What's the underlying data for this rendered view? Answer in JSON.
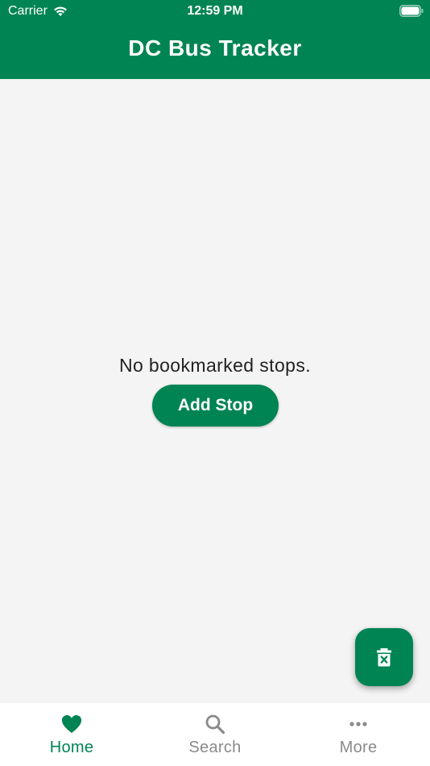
{
  "status_bar": {
    "carrier": "Carrier",
    "time": "12:59 PM"
  },
  "header": {
    "title": "DC Bus Tracker"
  },
  "main": {
    "empty_message": "No bookmarked stops.",
    "add_stop_label": "Add Stop"
  },
  "tabs": [
    {
      "label": "Home",
      "icon": "heart-icon",
      "active": true
    },
    {
      "label": "Search",
      "icon": "search-icon",
      "active": false
    },
    {
      "label": "More",
      "icon": "more-icon",
      "active": false
    }
  ],
  "colors": {
    "primary": "#008454",
    "background": "#f4f4f4",
    "inactive_tab": "#8a8a8a"
  }
}
